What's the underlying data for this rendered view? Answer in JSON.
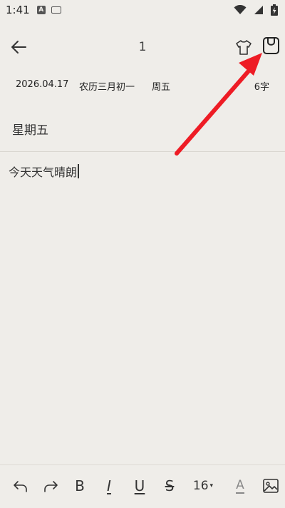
{
  "status_bar": {
    "time": "1:41",
    "notification_letter": "A",
    "icons": [
      "keyboard-icon",
      "wifi-icon",
      "signal-icon",
      "battery-charging-icon"
    ]
  },
  "header": {
    "title": "1",
    "icons": [
      "back-arrow-icon",
      "shirt-icon",
      "save-icon"
    ]
  },
  "info": {
    "date": "2026.04.17",
    "lunar": "农历三月初一",
    "weekday": "周五",
    "word_count": "6字"
  },
  "note": {
    "subtitle": "星期五",
    "content": "今天天气晴朗"
  },
  "annotation": {
    "arrow_color": "#ee1c25"
  },
  "toolbar": {
    "bold": "B",
    "italic": "I",
    "underline": "U",
    "strike": "S",
    "font_size": "16",
    "font_size_caret": "▾",
    "color_letter": "A",
    "icons": [
      "undo-icon",
      "redo-icon",
      "image-icon"
    ]
  },
  "colors": {
    "background": "#efede9",
    "text": "#222222",
    "arrow": "#ee1c25"
  }
}
